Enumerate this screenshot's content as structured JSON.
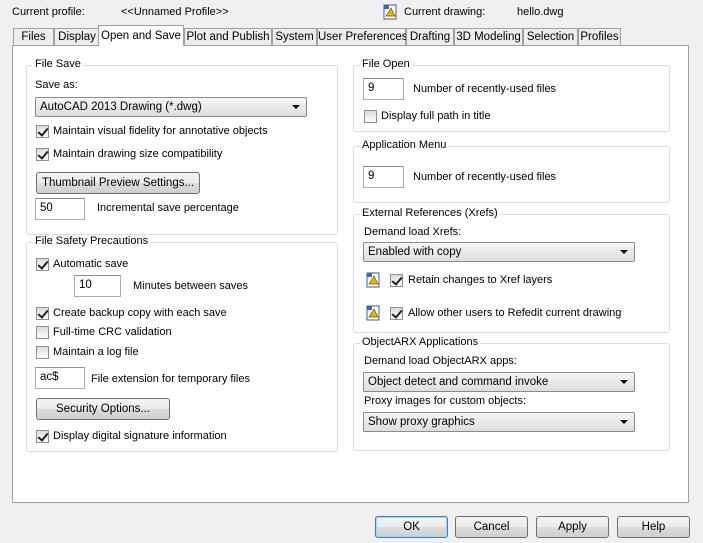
{
  "header": {
    "current_profile_label": "Current profile:",
    "current_profile_value": "<<Unnamed Profile>>",
    "current_drawing_label": "Current drawing:",
    "current_drawing_value": "hello.dwg"
  },
  "tabs": [
    {
      "label": "Files"
    },
    {
      "label": "Display"
    },
    {
      "label": "Open and Save"
    },
    {
      "label": "Plot and Publish"
    },
    {
      "label": "System"
    },
    {
      "label": "User Preferences"
    },
    {
      "label": "Drafting"
    },
    {
      "label": "3D Modeling"
    },
    {
      "label": "Selection"
    },
    {
      "label": "Profiles"
    }
  ],
  "file_save": {
    "title": "File Save",
    "save_as_label": "Save as:",
    "save_as_value": "AutoCAD 2013 Drawing (*.dwg)",
    "visual_fidelity": {
      "label": "Maintain visual fidelity for annotative objects",
      "checked": true
    },
    "drawing_size": {
      "label": "Maintain drawing size compatibility",
      "checked": true
    },
    "thumbnail_button": "Thumbnail Preview Settings...",
    "incremental_value": "50",
    "incremental_label": "Incremental save percentage"
  },
  "file_safety": {
    "title": "File Safety Precautions",
    "automatic_save": {
      "label": "Automatic save",
      "checked": true
    },
    "minutes_value": "10",
    "minutes_label": "Minutes between saves",
    "backup_copy": {
      "label": "Create backup copy with each save",
      "checked": true
    },
    "crc_validation": {
      "label": "Full-time CRC validation",
      "checked": false
    },
    "log_file": {
      "label": "Maintain a log file",
      "checked": false
    },
    "extension_value": "ac$",
    "extension_label": "File extension for temporary files",
    "security_button": "Security Options...",
    "digital_signature": {
      "label": "Display digital signature information",
      "checked": true
    }
  },
  "file_open": {
    "title": "File Open",
    "recent_value": "9",
    "recent_label": "Number of recently-used files",
    "full_path": {
      "label": "Display full path in title",
      "checked": false
    }
  },
  "app_menu": {
    "title": "Application Menu",
    "recent_value": "9",
    "recent_label": "Number of recently-used files"
  },
  "xrefs": {
    "title": "External References (Xrefs)",
    "demand_label": "Demand load Xrefs:",
    "demand_value": "Enabled with copy",
    "retain": {
      "label": "Retain changes to Xref layers",
      "checked": true
    },
    "refedit": {
      "label": "Allow other users to Refedit current drawing",
      "checked": true
    }
  },
  "objectarx": {
    "title": "ObjectARX Applications",
    "demand_label": "Demand load ObjectARX apps:",
    "demand_value": "Object detect and command invoke",
    "proxy_label": "Proxy images for custom objects:",
    "proxy_value": "Show proxy graphics"
  },
  "footer": {
    "ok": "OK",
    "cancel": "Cancel",
    "apply": "Apply",
    "help": "Help"
  },
  "icons": {
    "drawing_icon": "drawing-file-icon",
    "checkbox_checked": "checkmark-icon",
    "dropdown_arrow": "chevron-down-icon"
  }
}
